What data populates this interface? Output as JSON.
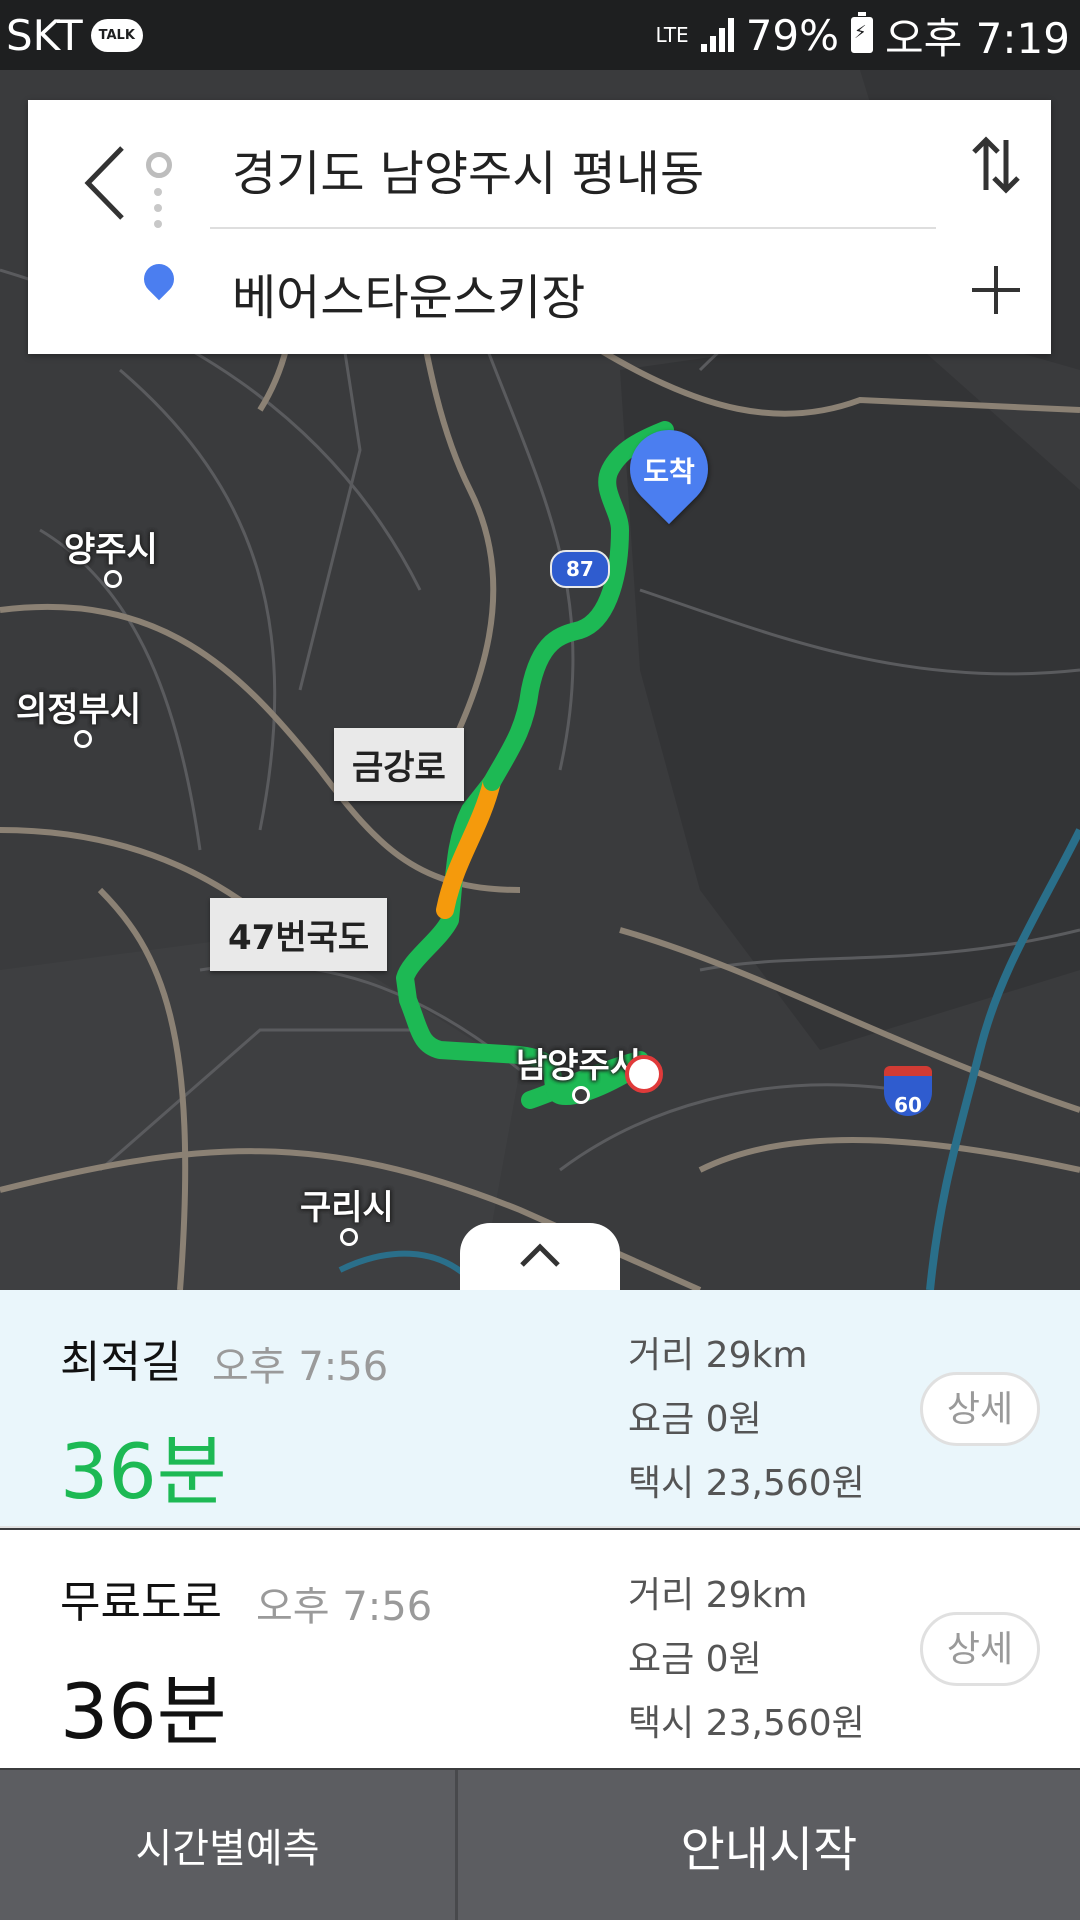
{
  "status_bar": {
    "carrier": "SKT",
    "talk_badge": "TALK",
    "network": "LTE",
    "battery": "79%",
    "time": "오후 7:19"
  },
  "search": {
    "origin": "경기도 남양주시 평내동",
    "destination": "베어스타운스키장"
  },
  "map": {
    "labels": {
      "yangju": "양주시",
      "uijeongbu": "의정부시",
      "guri": "구리시",
      "namyangju": "남양주시"
    },
    "road_tags": {
      "geumgang": "금강로",
      "route47": "47번국도"
    },
    "arrival_pin": "도착",
    "highway_87": "87",
    "highway_60": "60",
    "route_colors": {
      "smooth": "#1db954",
      "slow": "#f59a0c"
    }
  },
  "routes": [
    {
      "name": "최적길",
      "eta": "오후 7:56",
      "duration": "36분",
      "distance": "거리 29km",
      "toll": "요금 0원",
      "taxi": "택시 23,560원",
      "detail_label": "상세",
      "selected": true,
      "duration_color": "#1db954"
    },
    {
      "name": "무료도로",
      "eta": "오후 7:56",
      "duration": "36분",
      "distance": "거리 29km",
      "toll": "요금 0원",
      "taxi": "택시 23,560원",
      "detail_label": "상세",
      "selected": false,
      "duration_color": "#111111"
    }
  ],
  "bottom": {
    "forecast_label": "시간별예측",
    "start_label": "안내시작"
  }
}
